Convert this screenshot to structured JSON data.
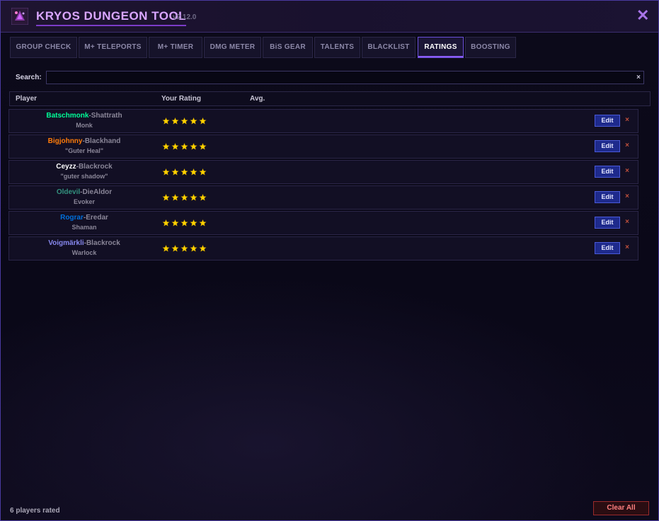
{
  "app": {
    "title": "KRYOS DUNGEON TOOL",
    "version": "v2.12.0",
    "close_glyph": "✕",
    "accent": "#d9a6ff"
  },
  "tabs": [
    {
      "label": "GROUP CHECK",
      "active": false
    },
    {
      "label": "M+ TELEPORTS",
      "active": false
    },
    {
      "label": "M+ TIMER",
      "active": false
    },
    {
      "label": "DMG METER",
      "active": false
    },
    {
      "label": "BiS GEAR",
      "active": false
    },
    {
      "label": "TALENTS",
      "active": false
    },
    {
      "label": "BLACKLIST",
      "active": false
    },
    {
      "label": "RATINGS",
      "active": true
    },
    {
      "label": "BOOSTING",
      "active": false
    }
  ],
  "search": {
    "label": "Search:",
    "value": "",
    "placeholder": "",
    "clear_glyph": "×"
  },
  "table": {
    "columns": [
      "Player",
      "Your Rating",
      "Avg."
    ],
    "rows": [
      {
        "name": "Batschmonk",
        "realm": "-Shattrath",
        "sub": "Monk",
        "name_color": "#00ff98",
        "rating": 5
      },
      {
        "name": "Bigjohnny",
        "realm": "-Blackhand",
        "sub": "\"Guter Heal\"",
        "name_color": "#ff7c0a",
        "rating": 5
      },
      {
        "name": "Ceyzz",
        "realm": "-Blackrock",
        "sub": "\"guter shadow\"",
        "name_color": "#ffffff",
        "rating": 5
      },
      {
        "name": "Oldevil",
        "realm": "-DieAldor",
        "sub": "Evoker",
        "name_color": "#33937f",
        "rating": 5
      },
      {
        "name": "Rograr",
        "realm": "-Eredar",
        "sub": "Shaman",
        "name_color": "#0070dd",
        "rating": 5
      },
      {
        "name": "Voigmärkli",
        "realm": "-Blackrock",
        "sub": "Warlock",
        "name_color": "#8788ee",
        "rating": 5
      }
    ],
    "edit_label": "Edit",
    "delete_glyph": "×",
    "star_color": "#ffd200"
  },
  "footer": {
    "count_text": "6 players rated",
    "clear_all_label": "Clear All"
  },
  "icons": {
    "logo": "dungeon-tool-logo-icon",
    "close": "close-icon",
    "search_clear": "clear-icon",
    "star": "star-icon",
    "delete": "delete-icon"
  }
}
